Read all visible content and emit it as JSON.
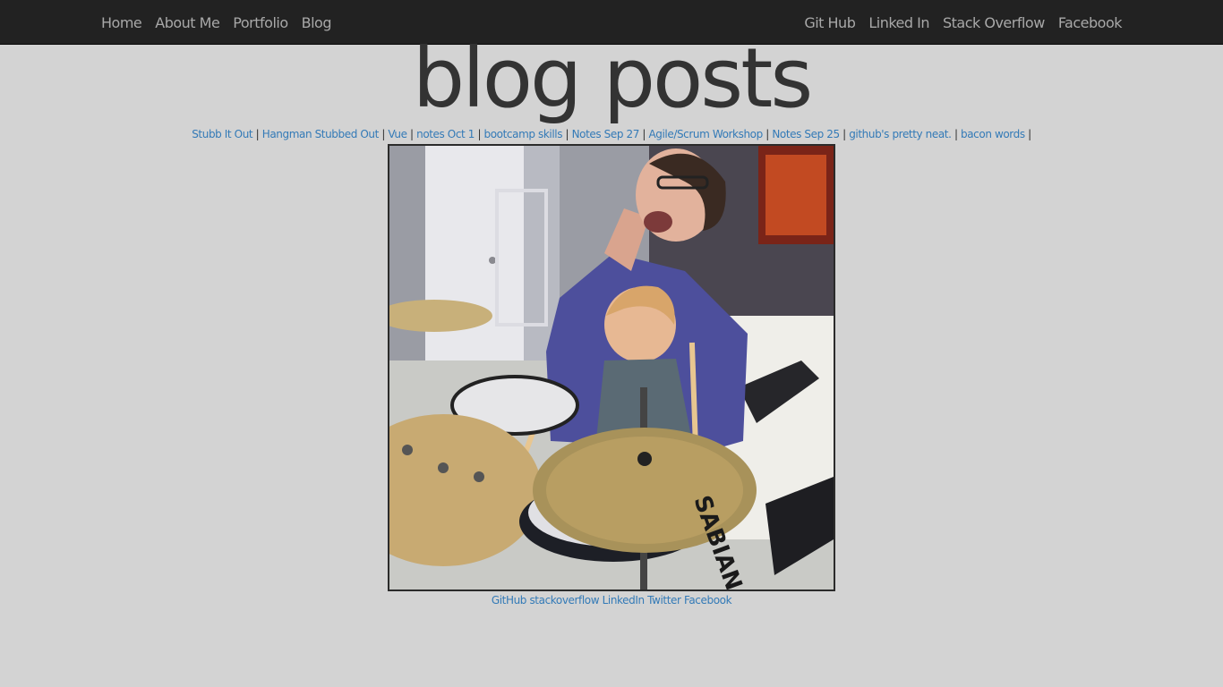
{
  "nav": {
    "left": [
      {
        "label": "Home"
      },
      {
        "label": "About Me"
      },
      {
        "label": "Portfolio"
      },
      {
        "label": "Blog"
      }
    ],
    "right": [
      {
        "label": "Git Hub"
      },
      {
        "label": "Linked In"
      },
      {
        "label": "Stack Overflow"
      },
      {
        "label": "Facebook"
      }
    ]
  },
  "page": {
    "title": "blog posts",
    "separator": "|"
  },
  "posts": [
    {
      "label": "Stubb It Out"
    },
    {
      "label": "Hangman Stubbed Out"
    },
    {
      "label": "Vue"
    },
    {
      "label": "notes Oct 1"
    },
    {
      "label": "bootcamp skills"
    },
    {
      "label": "Notes Sep 27"
    },
    {
      "label": "Agile/Scrum Workshop"
    },
    {
      "label": "Notes Sep 25"
    },
    {
      "label": "github's pretty neat."
    },
    {
      "label": "bacon words"
    }
  ],
  "photo": {
    "cymbal_text": "SABIAN"
  },
  "footer": {
    "links": [
      {
        "label": "GitHub"
      },
      {
        "label": "stackoverflow"
      },
      {
        "label": "LinkedIn"
      },
      {
        "label": "Twitter"
      },
      {
        "label": "Facebook"
      }
    ]
  },
  "colors": {
    "navbar_bg": "#222222",
    "nav_text": "#a8a8a8",
    "page_bg": "#d3d3d3",
    "link": "#337ab7",
    "title": "#333333"
  }
}
